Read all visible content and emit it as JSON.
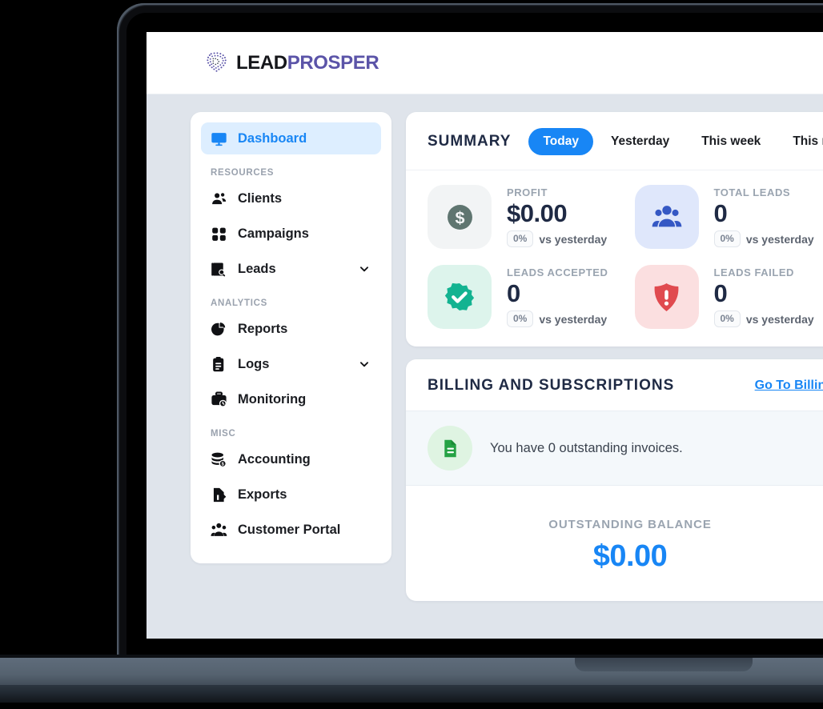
{
  "brand": {
    "logo_icon": "lead-prosper-dots-mark",
    "name_part1": "LEAD",
    "name_part2": "PROSPER",
    "accent_purple": "#5b54a8",
    "accent_blue": "#1886f5"
  },
  "sidebar": {
    "primary": {
      "label": "Dashboard",
      "icon": "desktop-monitor-icon",
      "active": true
    },
    "groups": [
      {
        "title": "RESOURCES",
        "items": [
          {
            "label": "Clients",
            "icon": "users-group-icon",
            "expandable": false
          },
          {
            "label": "Campaigns",
            "icon": "grid-squares-icon",
            "expandable": false
          },
          {
            "label": "Leads",
            "icon": "lead-search-icon",
            "expandable": true
          }
        ]
      },
      {
        "title": "ANALYTICS",
        "items": [
          {
            "label": "Reports",
            "icon": "pie-chart-icon",
            "expandable": false
          },
          {
            "label": "Logs",
            "icon": "clipboard-list-icon",
            "expandable": true
          },
          {
            "label": "Monitoring",
            "icon": "briefcase-clock-icon",
            "expandable": false
          }
        ]
      },
      {
        "title": "MISC",
        "items": [
          {
            "label": "Accounting",
            "icon": "coins-stack-icon",
            "expandable": false
          },
          {
            "label": "Exports",
            "icon": "file-export-icon",
            "expandable": false
          },
          {
            "label": "Customer Portal",
            "icon": "people-portal-icon",
            "expandable": false
          }
        ]
      }
    ]
  },
  "summary": {
    "title": "SUMMARY",
    "tabs": [
      {
        "label": "Today",
        "active": true
      },
      {
        "label": "Yesterday",
        "active": false
      },
      {
        "label": "This week",
        "active": false
      },
      {
        "label": "This month",
        "active": false
      }
    ],
    "stats": [
      {
        "label": "PROFIT",
        "value": "$0.00",
        "badge": "0%",
        "delta_text": "vs yesterday",
        "icon": "dollar-circle-icon",
        "icon_color": "#5f7570",
        "icon_bg": "#f2f4f5"
      },
      {
        "label": "TOTAL LEADS",
        "value": "0",
        "badge": "0%",
        "delta_text": "vs yesterday",
        "icon": "users-group-icon",
        "icon_color": "#3558c4",
        "icon_bg": "#dfe7fb"
      },
      {
        "label": "LEADS ACCEPTED",
        "value": "0",
        "badge": "0%",
        "delta_text": "vs yesterday",
        "icon": "badge-check-icon",
        "icon_color": "#13b391",
        "icon_bg": "#ddf4ec"
      },
      {
        "label": "LEADS FAILED",
        "value": "0",
        "badge": "0%",
        "delta_text": "vs yesterday",
        "icon": "shield-alert-icon",
        "icon_color": "#e04a4f",
        "icon_bg": "#fbdfe0"
      }
    ]
  },
  "billing": {
    "title": "BILLING AND SUBSCRIPTIONS",
    "link_label": "Go To Billing",
    "invoice_icon": "invoice-document-icon",
    "invoice_text": "You have 0 outstanding invoices.",
    "balance_label": "OUTSTANDING BALANCE",
    "balance_value": "$0.00"
  }
}
